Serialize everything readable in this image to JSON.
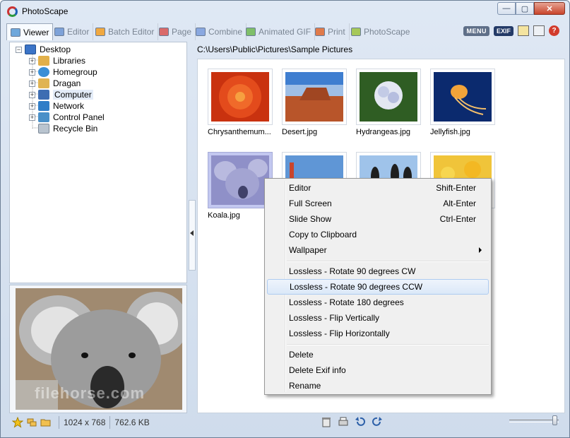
{
  "window": {
    "title": "PhotoScape",
    "minimize": "—",
    "maximize": "▢",
    "close": "✕"
  },
  "tabs": [
    {
      "label": "Viewer",
      "active": true,
      "color": "#2e6fb3"
    },
    {
      "label": "Editor",
      "active": false,
      "color": "#3a66b0"
    },
    {
      "label": "Batch Editor",
      "active": false,
      "color": "#d27a1c"
    },
    {
      "label": "Page",
      "active": false,
      "color": "#b03a3a"
    },
    {
      "label": "Combine",
      "active": false,
      "color": "#4a76c0"
    },
    {
      "label": "Animated GIF",
      "active": false,
      "color": "#3d8a3d"
    },
    {
      "label": "Print",
      "active": false,
      "color": "#c24a28"
    },
    {
      "label": "PhotoScape",
      "active": false,
      "color": "#6f9a2a"
    }
  ],
  "toolbar": {
    "menu_label": "MENU",
    "exif_label": "EXIF",
    "help_label": "?"
  },
  "tree": {
    "root": "Desktop",
    "items": [
      {
        "label": "Libraries",
        "color": "#e2b04a"
      },
      {
        "label": "Homegroup",
        "color": "#3a8fd6"
      },
      {
        "label": "Dragan",
        "color": "#e0b453"
      },
      {
        "label": "Computer",
        "color": "#3e6db2"
      },
      {
        "label": "Network",
        "color": "#2f7dc7"
      },
      {
        "label": "Control Panel",
        "color": "#4a90c8"
      },
      {
        "label": "Recycle Bin",
        "color": "#b9c4cf"
      }
    ]
  },
  "preview": {
    "watermark": "filehorse.com"
  },
  "status": {
    "dimensions": "1024 x 768",
    "filesize": "762.6 KB"
  },
  "browser": {
    "path": "C:\\Users\\Public\\Pictures\\Sample Pictures",
    "thumbnails": [
      {
        "name": "Chrysanthemum...",
        "selected": false
      },
      {
        "name": "Desert.jpg",
        "selected": false
      },
      {
        "name": "Hydrangeas.jpg",
        "selected": false
      },
      {
        "name": "Jellyfish.jpg",
        "selected": false
      },
      {
        "name": "Koala.jpg",
        "selected": true
      },
      {
        "name": "",
        "selected": false
      },
      {
        "name": "",
        "selected": false
      },
      {
        "name": "",
        "selected": false
      }
    ]
  },
  "context_menu": {
    "items": [
      {
        "label": "Editor",
        "shortcut": "Shift-Enter"
      },
      {
        "label": "Full Screen",
        "shortcut": "Alt-Enter"
      },
      {
        "label": "Slide Show",
        "shortcut": "Ctrl-Enter"
      },
      {
        "label": "Copy to Clipboard",
        "shortcut": ""
      },
      {
        "label": "Wallpaper",
        "shortcut": ""
      },
      {
        "label": "Lossless - Rotate 90 degrees CW",
        "shortcut": ""
      },
      {
        "label": "Lossless - Rotate 90 degrees CCW",
        "shortcut": ""
      },
      {
        "label": "Lossless - Rotate 180 degrees",
        "shortcut": ""
      },
      {
        "label": "Lossless - Flip Vertically",
        "shortcut": ""
      },
      {
        "label": "Lossless - Flip Horizontally",
        "shortcut": ""
      },
      {
        "label": "Delete",
        "shortcut": ""
      },
      {
        "label": "Delete Exif info",
        "shortcut": ""
      },
      {
        "label": "Rename",
        "shortcut": ""
      }
    ]
  },
  "zoom": {
    "level": 1.0
  }
}
